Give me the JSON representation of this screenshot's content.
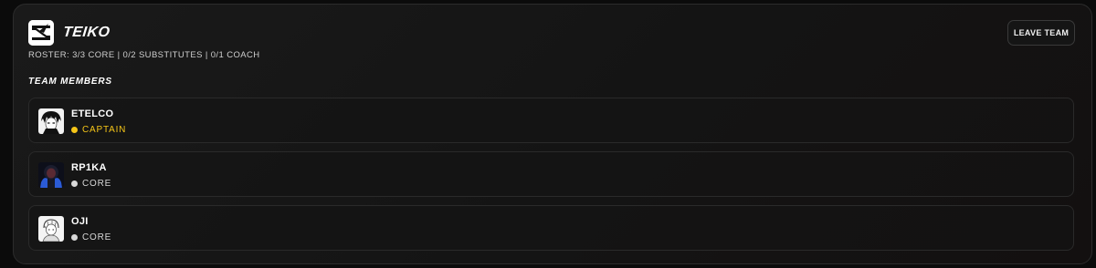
{
  "team": {
    "name": "TEIKO",
    "roster": "ROSTER: 3/3 CORE | 0/2 SUBSTITUTES | 0/1 COACH",
    "leave_label": "LEAVE TEAM",
    "members_title": "TEAM MEMBERS"
  },
  "members": [
    {
      "name": "ETELCO",
      "role": "CAPTAIN",
      "role_color": "#f5c518",
      "avatar_icon": "avatar-manga-portrait"
    },
    {
      "name": "RP1KA",
      "role": "CORE",
      "role_color": "#d8d8d8",
      "avatar_icon": "avatar-dark-blue-portrait"
    },
    {
      "name": "OJI",
      "role": "CORE",
      "role_color": "#d8d8d8",
      "avatar_icon": "avatar-sketch-portrait"
    }
  ],
  "colors": {
    "captain": "#f5c518",
    "core": "#d8d8d8"
  }
}
